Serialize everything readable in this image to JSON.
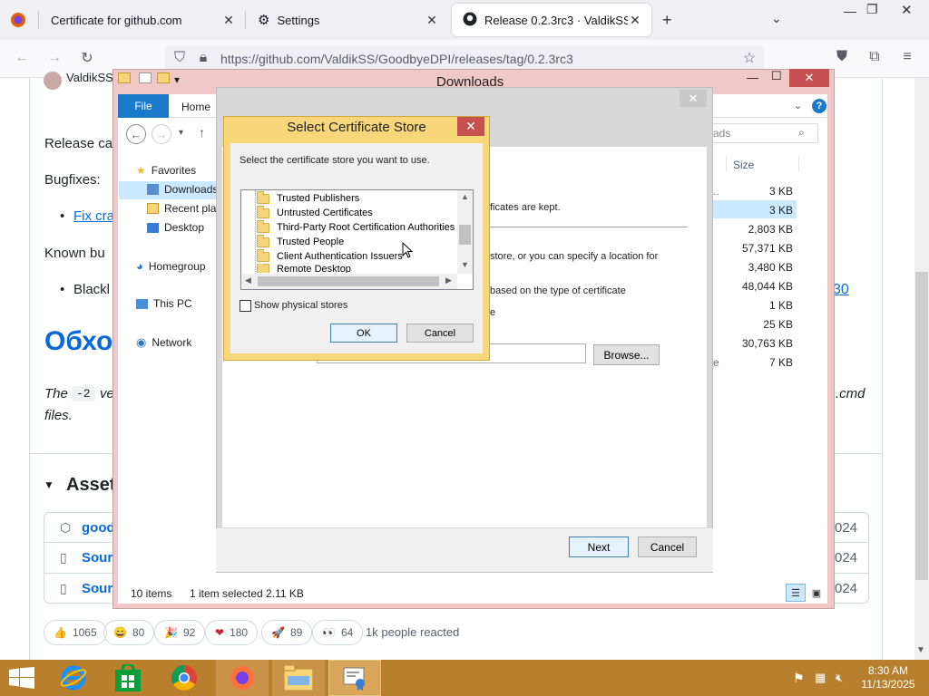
{
  "browser": {
    "tabs": [
      {
        "label": "Certificate for github.com"
      },
      {
        "label": "Settings"
      },
      {
        "label": "Release 0.2.3rc3 · ValdikSS/Goo"
      }
    ],
    "url": "https://github.com/ValdikSS/GoodbyeDPI/releases/tag/0.2.3rc3"
  },
  "github": {
    "author": "ValdikSS",
    "release_line": "Release ca",
    "bugfixes": "Bugfixes:",
    "bug_link": "Fix cra",
    "known_bugs": "Known bu",
    "blacklist": "Blackl",
    "heading_ru": "Обхо",
    "flag_text_pre": "The",
    "flag_code": "-2",
    "flag_text_post": "ve",
    "cmd_text": ".cmd",
    "files_text": "files.",
    "link_30": "30",
    "assets_title": "Asset",
    "assets": [
      {
        "name": "good",
        "date": "024"
      },
      {
        "name": "Sour",
        "date": "024"
      },
      {
        "name": "Sour",
        "date": "024"
      }
    ],
    "reactions": [
      {
        "emoji": "👍",
        "count": "1065"
      },
      {
        "emoji": "😄",
        "count": "80"
      },
      {
        "emoji": "🎉",
        "count": "92"
      },
      {
        "emoji": "❤",
        "count": "180"
      },
      {
        "emoji": "🚀",
        "count": "89"
      },
      {
        "emoji": "👀",
        "count": "64"
      }
    ],
    "reacted_text": "1k people reacted"
  },
  "explorer": {
    "title": "Downloads",
    "ribbon_file": "File",
    "ribbon_home": "Home",
    "search_placeholder": "ads",
    "size_header": "Size",
    "nav": {
      "favorites": "Favorites",
      "downloads": "Downloads",
      "recent": "Recent plac",
      "desktop": "Desktop",
      "homegroup": "Homegroup",
      "thispc": "This PC",
      "network": "Network"
    },
    "sizes": [
      "3 KB",
      "3 KB",
      "2,803 KB",
      "57,371 KB",
      "3,480 KB",
      "48,044 KB",
      "1 KB",
      "25 KB",
      "30,763 KB",
      "7 KB"
    ],
    "status_items": "10 items",
    "status_selected": "1 item selected  2.11 KB"
  },
  "wizard": {
    "text_kept": "ficates are kept.",
    "text_store": "store, or you can specify a location for",
    "text_based": "based on the type of certificate",
    "text_e": "e",
    "browse_label": "Browse...",
    "next_label": "Next",
    "cancel_label": "Cancel"
  },
  "dialog": {
    "title": "Select Certificate Store",
    "instruction": "Select the certificate store you want to use.",
    "stores": [
      "Trusted Publishers",
      "Untrusted Certificates",
      "Third-Party Root Certification Authorities",
      "Trusted People",
      "Client Authentication Issuers",
      "Remote Desktop"
    ],
    "show_physical": "Show physical stores",
    "ok_label": "OK",
    "cancel_label": "Cancel"
  },
  "taskbar": {
    "time": "8:30 AM",
    "date": "11/13/2025"
  }
}
